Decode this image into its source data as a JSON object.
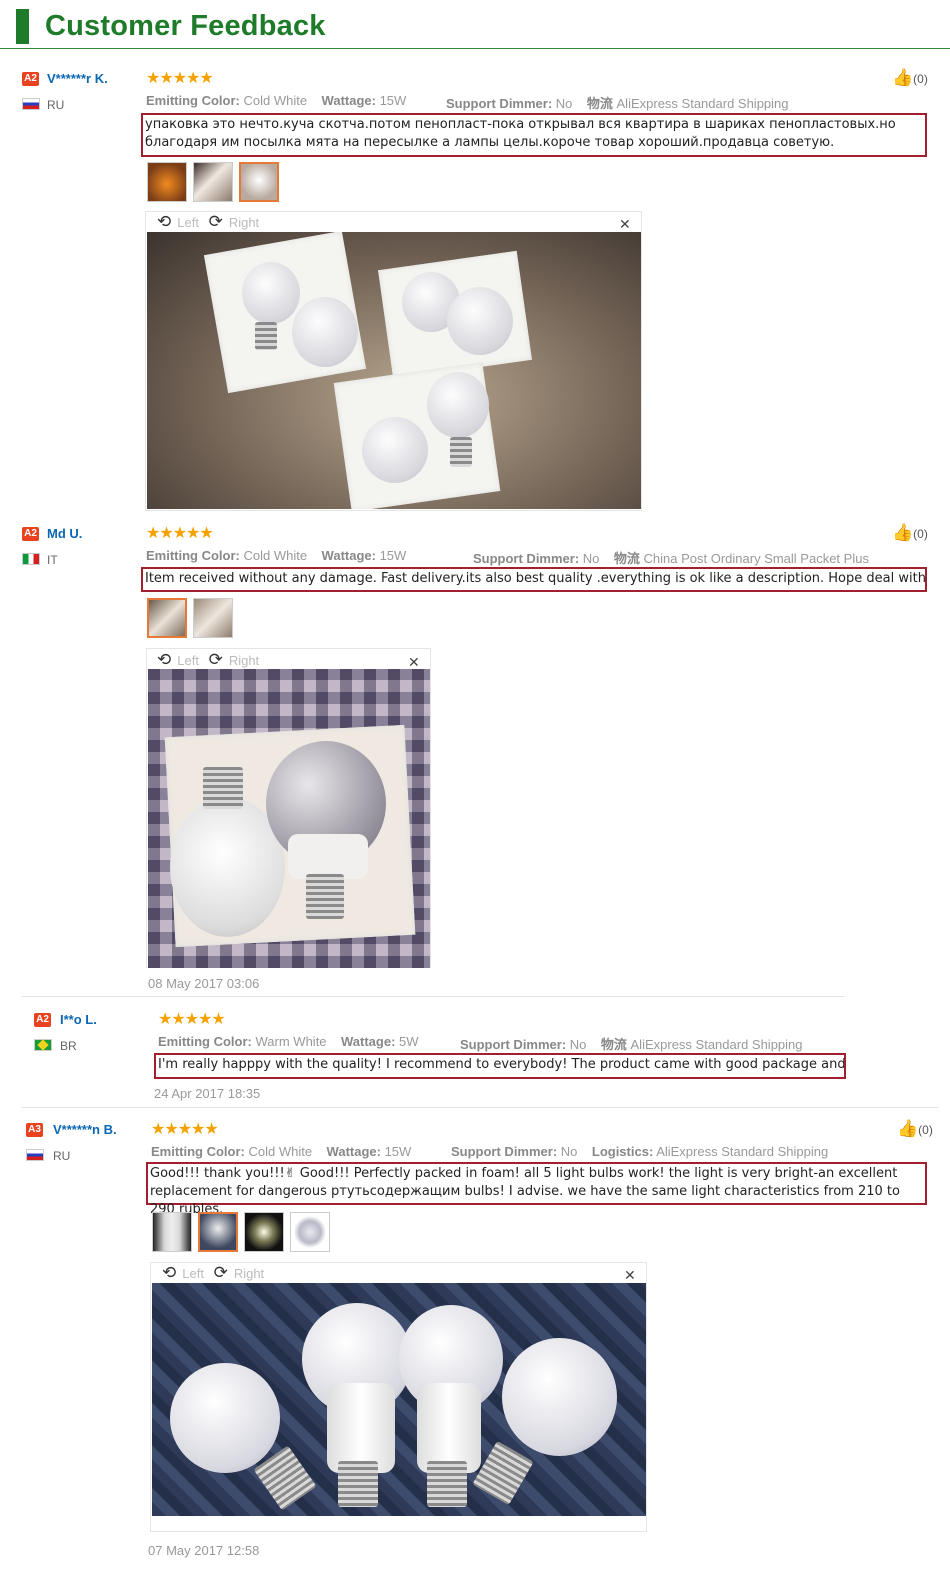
{
  "header": {
    "title": "Customer Feedback"
  },
  "labels": {
    "emitting_color": "Emitting Color:",
    "wattage": "Wattage:",
    "support_dimmer": "Support Dimmer:",
    "logistics_cn": "物流",
    "logistics_en": "Logistics:",
    "left": "Left",
    "right": "Right"
  },
  "reviews": [
    {
      "level": "A2",
      "name": "V******r K.",
      "country": "RU",
      "stars": "★★★★★",
      "emitting_color": "Cold White",
      "wattage": "15W",
      "support_dimmer": "No",
      "shipping": "AliExpress Standard Shipping",
      "text": "упаковка это нечто.куча скотча.потом пенопласт-пока открывал вся квартира в шариках пенопластовых.но благодаря им посылка мята на пересылке а лампы целы.короче товар хороший.продавца советую.",
      "likes": "(0)"
    },
    {
      "level": "A2",
      "name": "Md U.",
      "country": "IT",
      "stars": "★★★★★",
      "emitting_color": "Cold White",
      "wattage": "15W",
      "support_dimmer": "No",
      "shipping": "China Post Ordinary Small Packet Plus",
      "text": "Item received without any damage. Fast delivery.its also best quality .everything is ok like a description. Hope deal with you again.",
      "date": "08 May 2017 03:06",
      "likes": "(0)"
    },
    {
      "level": "A2",
      "name": "I**o L.",
      "country": "BR",
      "stars": "★★★★★",
      "emitting_color": "Warm White",
      "wattage": "5W",
      "support_dimmer": "No",
      "shipping": "AliExpress Standard Shipping",
      "text": "I'm really happpy with the quality! I recommend to everybody! The product came with good package and safety.",
      "date": "24 Apr 2017 18:35"
    },
    {
      "level": "A3",
      "name": "V******n B.",
      "country": "RU",
      "stars": "★★★★★",
      "emitting_color": "Cold White",
      "wattage": "15W",
      "support_dimmer": "No",
      "shipping": "AliExpress Standard Shipping",
      "text": "Good!!! thank you!!!✌ Good!!! Perfectly packed in foam! all 5 light bulbs work! the light is very bright-an excellent replacement for dangerous ртутьсодержащим bulbs! I advise. we have the same light characteristics from 210 to 290 rubles.",
      "date": "07 May 2017 12:58",
      "likes": "(0)"
    }
  ],
  "icons": {
    "like": "thumbs-up-icon",
    "rotate_left": "rotate-left-icon",
    "rotate_right": "rotate-right-icon",
    "close": "close-icon"
  },
  "colors": {
    "header_green": "#1e7b2a",
    "highlight_border": "#a21f2d",
    "star": "#f5a200",
    "username": "#0b67b3",
    "level_badge": "#e8421f"
  }
}
